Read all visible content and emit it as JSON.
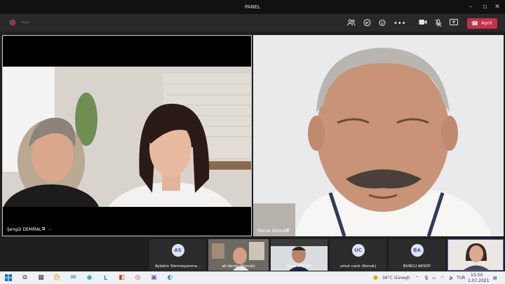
{
  "window": {
    "title": "PANEL"
  },
  "toolbar": {
    "timer": "--:--",
    "leave_label": "Ayrıl"
  },
  "main_tiles": [
    {
      "name": "Şengül DEMİRAL"
    },
    {
      "name": "Merve (Konuk)"
    }
  ],
  "gallery": [
    {
      "initials": "AS",
      "name": "Aytekin Sönmeyenma..."
    },
    {
      "initials": "",
      "name": "ali demir (Konuk)"
    },
    {
      "initials": "",
      "name": "Seyfi TAŞTAŞ"
    },
    {
      "initials": "UC",
      "name": "umut canlı (Konuk)"
    },
    {
      "initials": "BA",
      "name": "BURCU AKSOY"
    },
    {
      "initials": "",
      "name": ""
    }
  ],
  "taskbar": {
    "weather": "36°C  Güneşli",
    "language": "TUR",
    "time": "15:50",
    "date": "1.07.2021"
  },
  "colors": {
    "leave": "#c4314b",
    "avatar_bg": "#dfe3f2",
    "avatar_fg": "#4a5aa8"
  }
}
